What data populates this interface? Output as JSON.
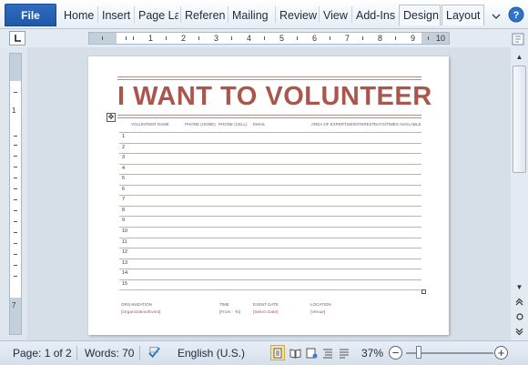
{
  "ribbon": {
    "file_label": "File",
    "tabs": [
      "Home",
      "Insert",
      "Page La",
      "Referen",
      "Mailing",
      "Review",
      "View",
      "Add-Ins",
      "Design",
      "Layout"
    ],
    "active_tab": "Design",
    "minimize_icon": "chevron-down-icon",
    "help_icon": "help-icon"
  },
  "ruler": {
    "h_numbers": [
      "1",
      "2",
      "3",
      "4",
      "5",
      "6",
      "7",
      "8",
      "9",
      "10"
    ],
    "v_numbers": [
      "1",
      "7"
    ]
  },
  "document": {
    "title": "I WANT TO VOLUNTEER",
    "columns": [
      "VOLUNTEER NAME",
      "PHONE (HOME)",
      "PHONE (CELL)",
      "EMAIL",
      "AREA OF EXPERTISE/INTEREST",
      "DAYS/TIMES AVAILABLE"
    ],
    "rows": [
      "1",
      "2",
      "3",
      "4",
      "5",
      "6",
      "7",
      "8",
      "9",
      "10",
      "11",
      "12",
      "13",
      "14",
      "15"
    ],
    "footer": {
      "labels": [
        "ORGANIZATION",
        "TIME",
        "EVENT DATE",
        "LOCATION"
      ],
      "values": [
        "[Organization/Event]",
        "[From - To]",
        "[Select Date]",
        "[Venue]"
      ]
    }
  },
  "status_bar": {
    "page": "Page: 1 of 2",
    "words": "Words: 70",
    "language": "English (U.S.)",
    "zoom": "37%",
    "zoom_minus": "−",
    "zoom_plus": "+",
    "zoom_level": 0.37
  },
  "colors": {
    "title": "#a9564c",
    "file_tab": "#2f6cc0",
    "ribbon_bg": "#e6edf5"
  }
}
